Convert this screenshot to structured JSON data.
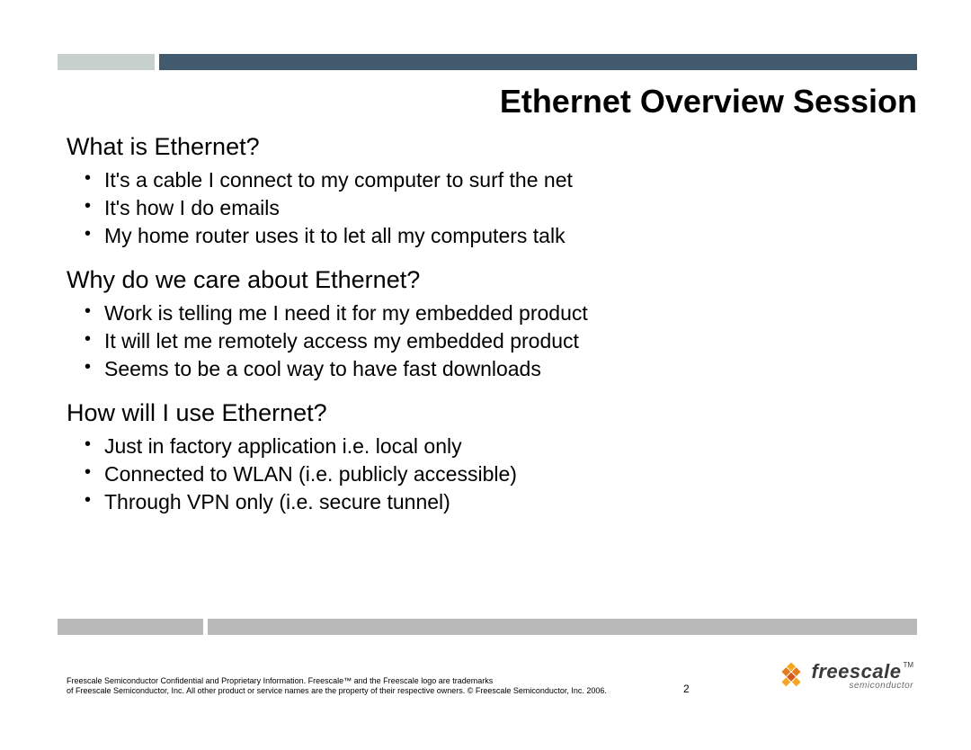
{
  "title": "Ethernet Overview Session",
  "sections": [
    {
      "heading": "What is Ethernet?",
      "bullets": [
        "It's a cable I connect to my computer to surf the net",
        "It's how I do emails",
        "My home router uses it to let all my computers talk"
      ]
    },
    {
      "heading": "Why do we care about Ethernet?",
      "bullets": [
        "Work is telling me I need it for my embedded product",
        "It will let me remotely access my embedded product",
        "Seems to be a cool way to have fast downloads"
      ]
    },
    {
      "heading": "How will I use Ethernet?",
      "bullets": [
        "Just in factory application i.e. local only",
        "Connected to WLAN (i.e. publicly accessible)",
        "Through VPN only (i.e. secure tunnel)"
      ]
    }
  ],
  "footer": {
    "line1": "Freescale Semiconductor Confidential and Proprietary Information. Freescale™ and the Freescale logo are trademarks",
    "line2": "of Freescale Semiconductor, Inc. All other product or service names are the property of their respective owners. © Freescale Semiconductor, Inc. 2006."
  },
  "page_number": "2",
  "logo": {
    "name": "freescale",
    "tm": "TM",
    "sub": "semiconductor"
  },
  "colors": {
    "bar_light": "#c8d0ce",
    "bar_dark": "#425a6e",
    "bottom_bar": "#b9b9b9"
  }
}
